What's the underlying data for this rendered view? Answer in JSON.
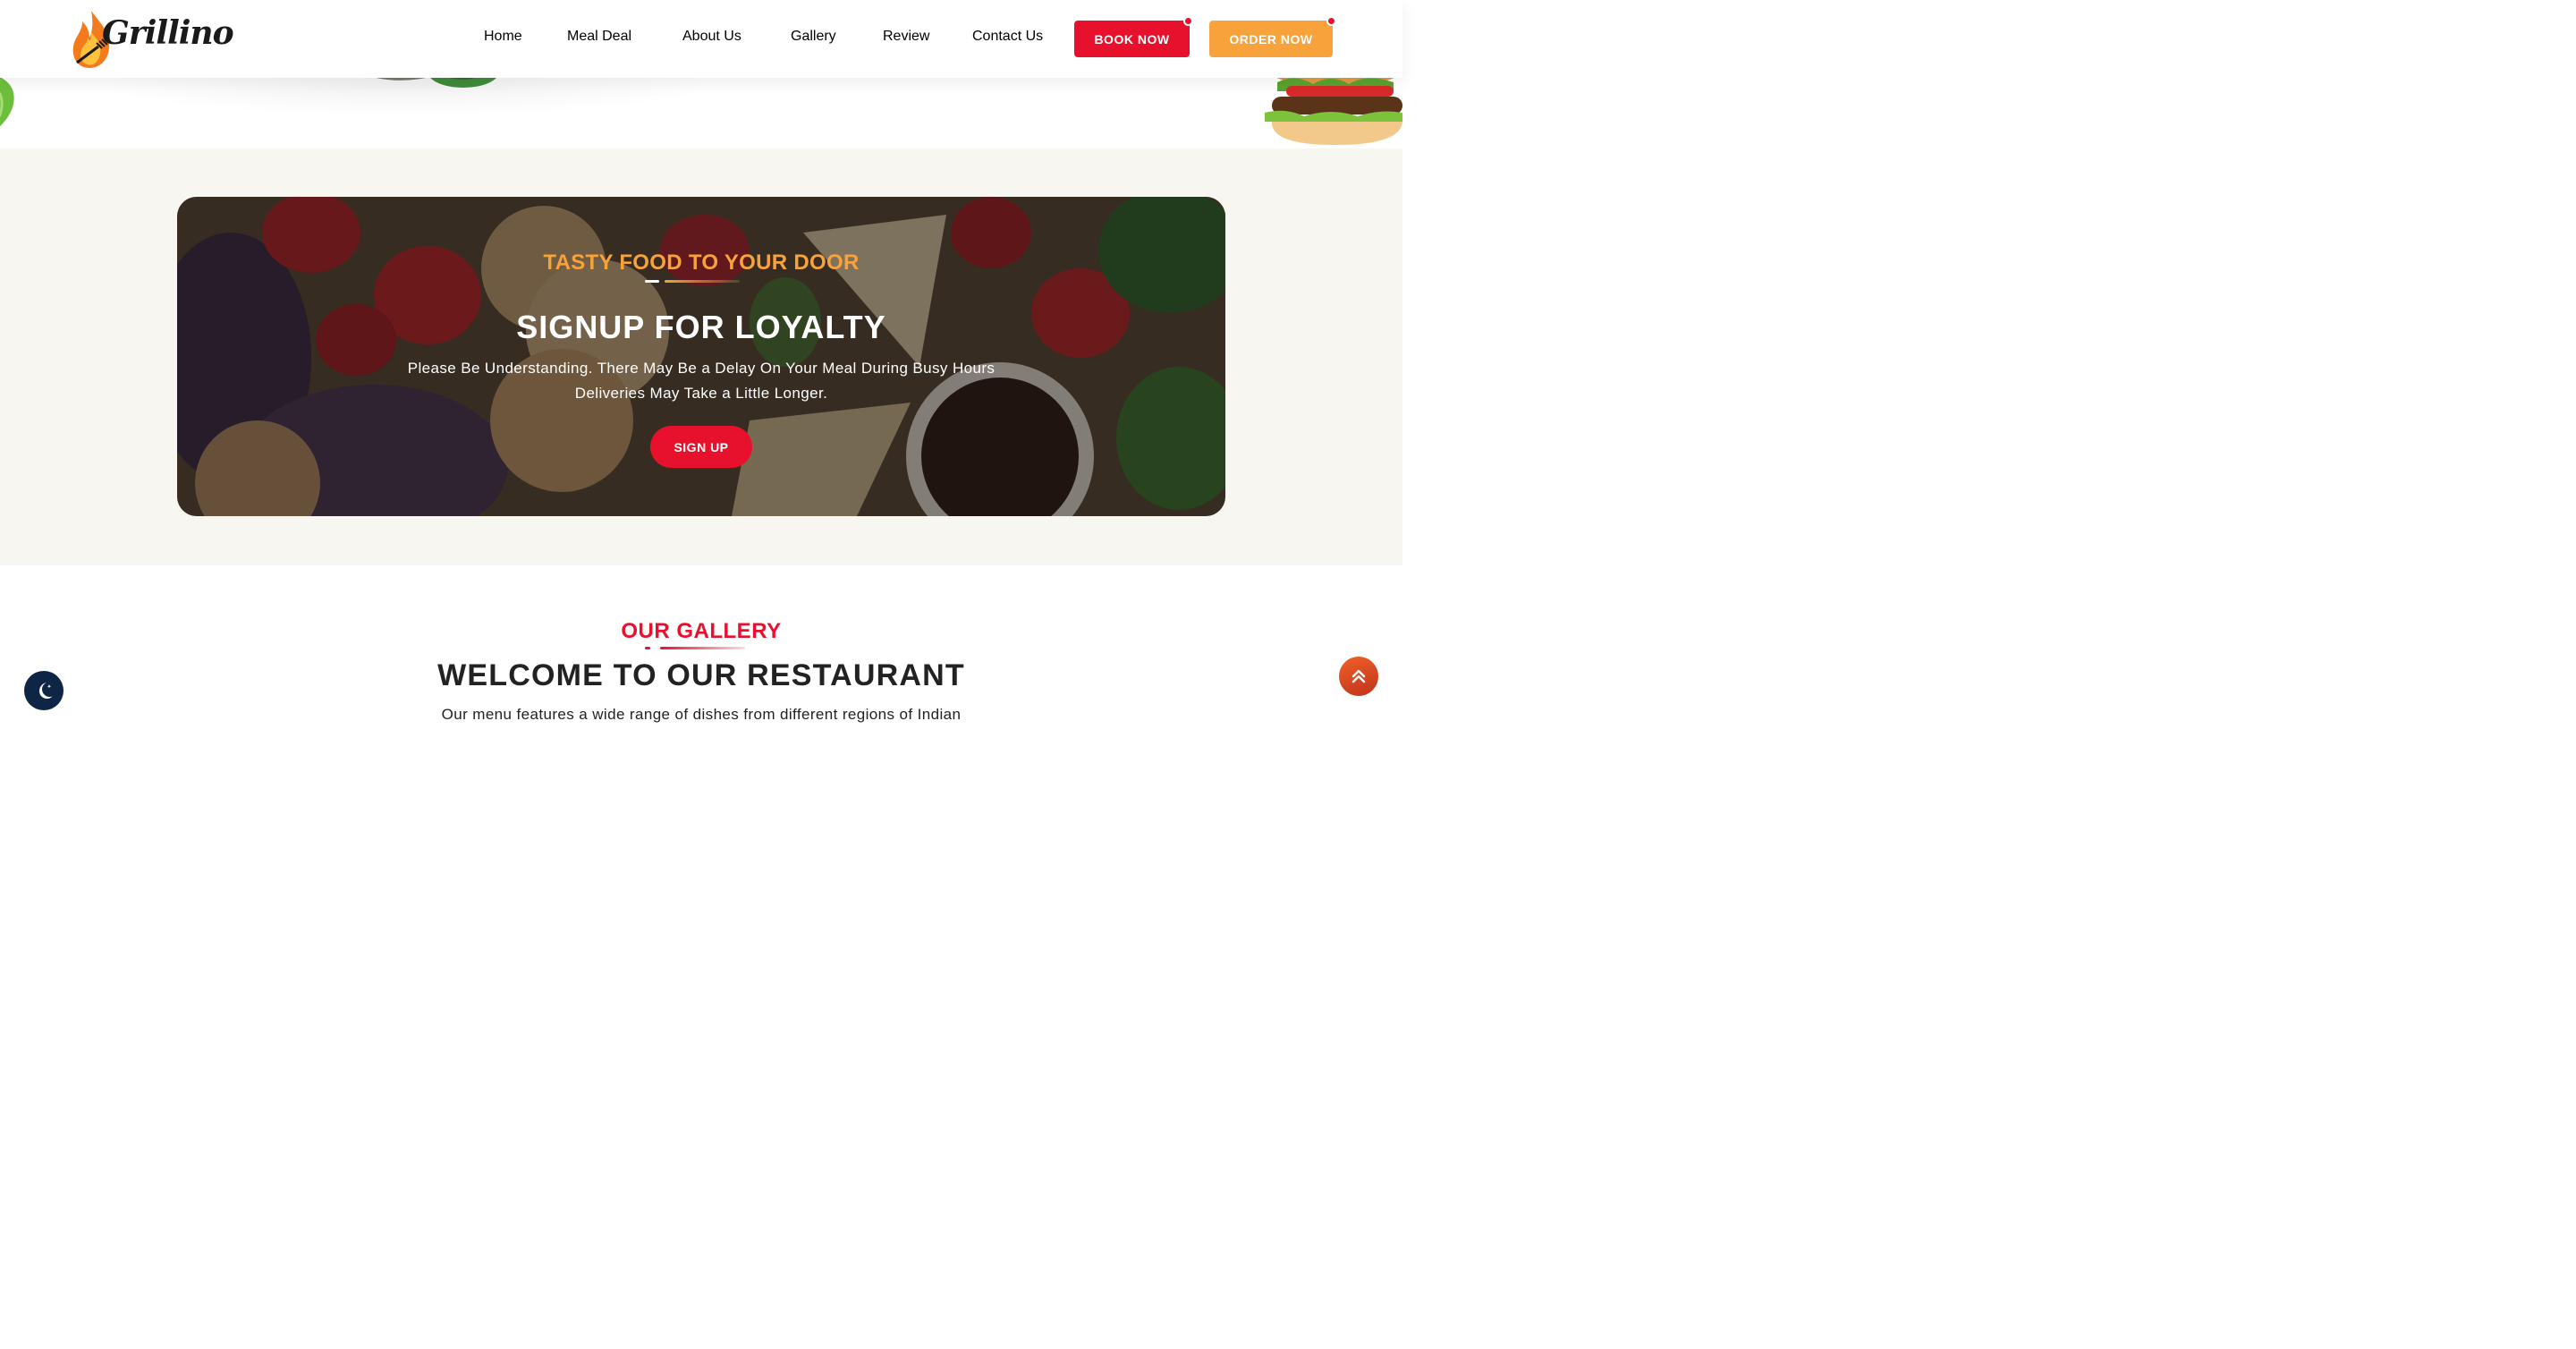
{
  "brand": {
    "name": "Grillino"
  },
  "nav": {
    "items": [
      {
        "label": "Home"
      },
      {
        "label": "Meal Deal"
      },
      {
        "label": "About Us"
      },
      {
        "label": "Gallery"
      },
      {
        "label": "Review"
      },
      {
        "label": "Contact Us"
      }
    ],
    "book_label": "BOOK NOW",
    "order_label": "ORDER NOW"
  },
  "loyalty": {
    "eyebrow": "TASTY FOOD TO YOUR DOOR",
    "title": "SIGNUP FOR LOYALTY",
    "text_line1": "Please Be Understanding. There May Be a Delay On Your Meal During Busy Hours",
    "text_line2": "Deliveries May Take a Little Longer.",
    "button_label": "SIGN UP"
  },
  "gallery": {
    "eyebrow": "OUR GALLERY",
    "title": "WELCOME TO OUR RESTAURANT",
    "text": "Our menu features a wide range of dishes from different regions of Indian"
  },
  "colors": {
    "primary_red": "#e8112d",
    "accent_orange": "#f7a23b",
    "dark_navy": "#0f2546",
    "section_bg": "#f8f6f1"
  },
  "icons": {
    "theme_toggle": "moon-icon",
    "scroll_top": "double-chevron-up-icon"
  }
}
